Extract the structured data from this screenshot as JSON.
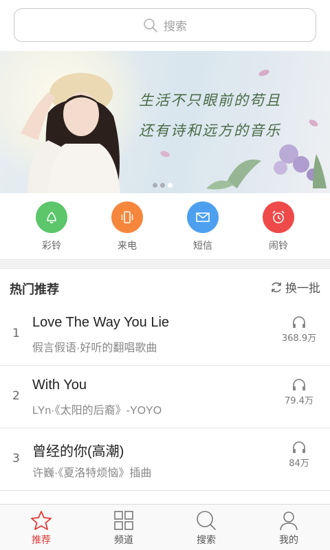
{
  "search": {
    "placeholder": "搜索"
  },
  "banner": {
    "line1": "生活不只眼前的苟且",
    "line2": "还有诗和远方的音乐"
  },
  "quick_actions": [
    {
      "label": "彩铃",
      "icon": "bell-icon",
      "color": "#5cc66b"
    },
    {
      "label": "来电",
      "icon": "phone-vibrate-icon",
      "color": "#f5873d"
    },
    {
      "label": "短信",
      "icon": "envelope-icon",
      "color": "#4da0ef"
    },
    {
      "label": "闹铃",
      "icon": "alarm-clock-icon",
      "color": "#ef4a4a"
    }
  ],
  "hot": {
    "title": "热门推荐",
    "refresh_label": "换一批",
    "songs": [
      {
        "rank": "1",
        "title": "Love The Way You Lie",
        "subtitle": "假言假语·好听的翻唱歌曲",
        "plays": "368.9万"
      },
      {
        "rank": "2",
        "title": "With You",
        "subtitle": "LYn·《太阳的后裔》-YOYO",
        "plays": "79.4万"
      },
      {
        "rank": "3",
        "title": "曾经的你(高潮)",
        "subtitle": "许巍·《夏洛特烦恼》插曲",
        "plays": "84万"
      }
    ]
  },
  "nav": [
    {
      "label": "推荐",
      "icon": "star-icon",
      "active": true
    },
    {
      "label": "频道",
      "icon": "grid-icon",
      "active": false
    },
    {
      "label": "搜索",
      "icon": "search-icon",
      "active": false
    },
    {
      "label": "我的",
      "icon": "user-icon",
      "active": false
    }
  ],
  "colors": {
    "accent": "#e53935"
  }
}
